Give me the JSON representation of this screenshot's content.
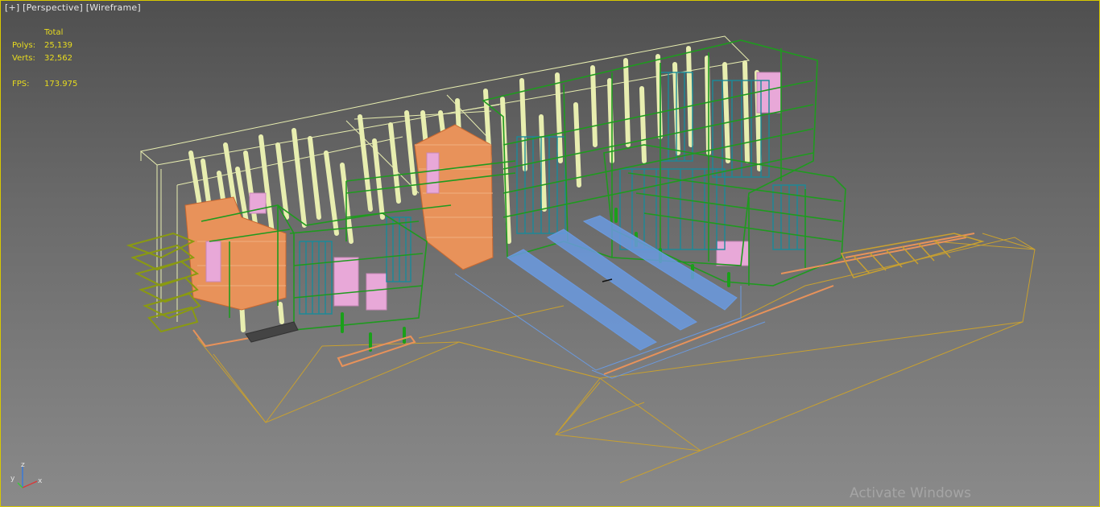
{
  "viewport": {
    "label": {
      "plus": "[+]",
      "view": "[Perspective]",
      "mode": "[Wireframe]"
    },
    "stats": {
      "header": "Total",
      "polys_label": "Polys:",
      "polys_value": "25,139",
      "verts_label": "Verts:",
      "verts_value": "32,562",
      "fps_label": "FPS:",
      "fps_value": "173.975"
    },
    "axis": {
      "x": "x",
      "y": "y",
      "z": "z"
    },
    "watermark": "Activate Windows",
    "colors": {
      "border": "#d8c800",
      "stats_text": "#e8dc1e",
      "wire_green": "#1f9a1f",
      "wire_cream": "#e8eeb0",
      "wire_orange": "#e8925a",
      "wire_blue": "#6a9ae0",
      "wire_teal": "#1a8a9a",
      "wire_pink": "#e8a8d8",
      "wire_gold": "#c8a030",
      "wire_olive": "#8a9a10"
    }
  }
}
